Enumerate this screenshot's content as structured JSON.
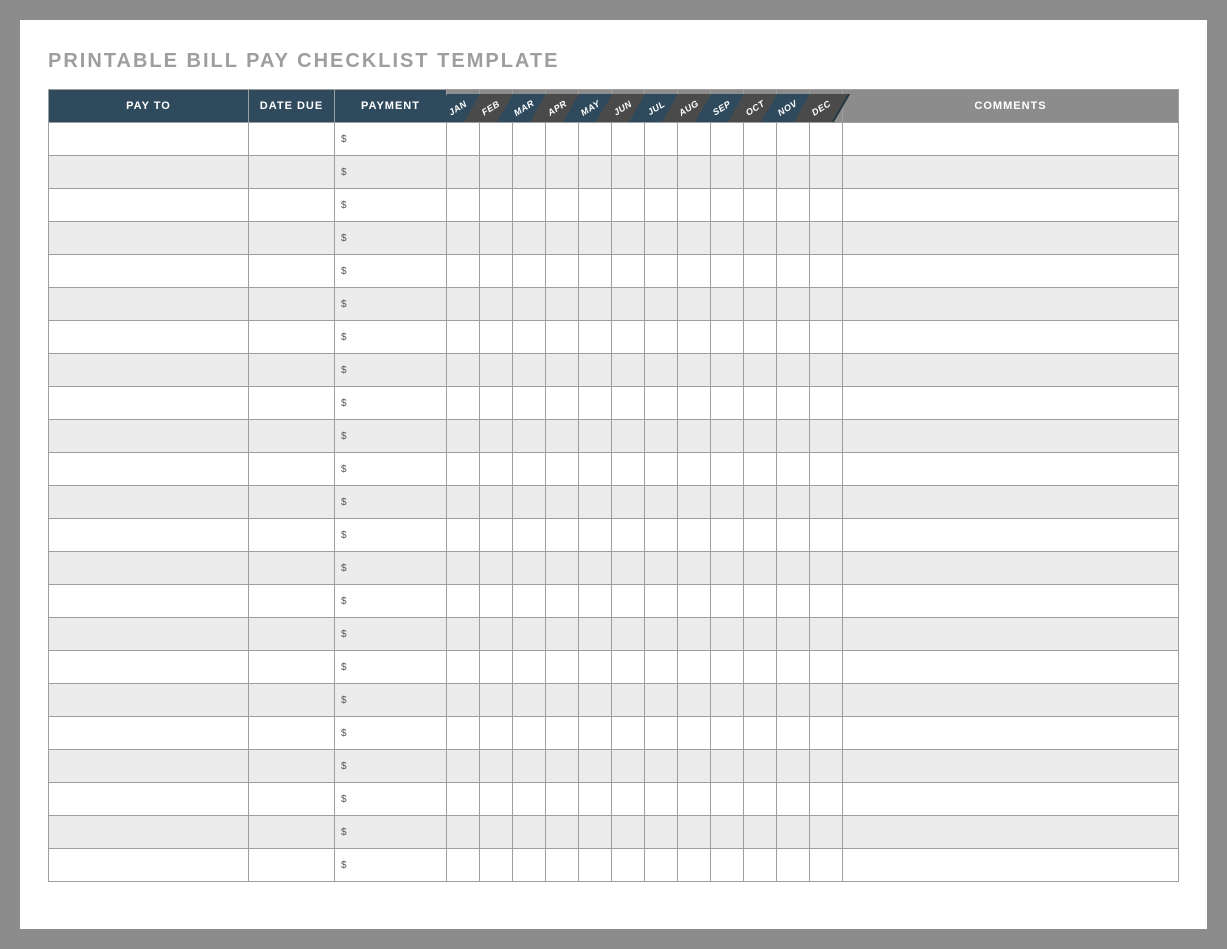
{
  "title": "PRINTABLE BILL PAY CHECKLIST TEMPLATE",
  "headers": {
    "payto": "PAY TO",
    "datedue": "DATE DUE",
    "payment": "PAYMENT",
    "comments": "COMMENTS"
  },
  "months": [
    "JAN",
    "FEB",
    "MAR",
    "APR",
    "MAY",
    "JUN",
    "JUL",
    "AUG",
    "SEP",
    "OCT",
    "NOV",
    "DEC"
  ],
  "currency_symbol": "$",
  "row_count": 23,
  "rows": [
    {
      "payto": "",
      "datedue": "",
      "payment": "",
      "comments": ""
    },
    {
      "payto": "",
      "datedue": "",
      "payment": "",
      "comments": ""
    },
    {
      "payto": "",
      "datedue": "",
      "payment": "",
      "comments": ""
    },
    {
      "payto": "",
      "datedue": "",
      "payment": "",
      "comments": ""
    },
    {
      "payto": "",
      "datedue": "",
      "payment": "",
      "comments": ""
    },
    {
      "payto": "",
      "datedue": "",
      "payment": "",
      "comments": ""
    },
    {
      "payto": "",
      "datedue": "",
      "payment": "",
      "comments": ""
    },
    {
      "payto": "",
      "datedue": "",
      "payment": "",
      "comments": ""
    },
    {
      "payto": "",
      "datedue": "",
      "payment": "",
      "comments": ""
    },
    {
      "payto": "",
      "datedue": "",
      "payment": "",
      "comments": ""
    },
    {
      "payto": "",
      "datedue": "",
      "payment": "",
      "comments": ""
    },
    {
      "payto": "",
      "datedue": "",
      "payment": "",
      "comments": ""
    },
    {
      "payto": "",
      "datedue": "",
      "payment": "",
      "comments": ""
    },
    {
      "payto": "",
      "datedue": "",
      "payment": "",
      "comments": ""
    },
    {
      "payto": "",
      "datedue": "",
      "payment": "",
      "comments": ""
    },
    {
      "payto": "",
      "datedue": "",
      "payment": "",
      "comments": ""
    },
    {
      "payto": "",
      "datedue": "",
      "payment": "",
      "comments": ""
    },
    {
      "payto": "",
      "datedue": "",
      "payment": "",
      "comments": ""
    },
    {
      "payto": "",
      "datedue": "",
      "payment": "",
      "comments": ""
    },
    {
      "payto": "",
      "datedue": "",
      "payment": "",
      "comments": ""
    },
    {
      "payto": "",
      "datedue": "",
      "payment": "",
      "comments": ""
    },
    {
      "payto": "",
      "datedue": "",
      "payment": "",
      "comments": ""
    },
    {
      "payto": "",
      "datedue": "",
      "payment": "",
      "comments": ""
    }
  ],
  "chart_data": {
    "type": "table",
    "title": "Printable Bill Pay Checklist",
    "columns": [
      "PAY TO",
      "DATE DUE",
      "PAYMENT",
      "JAN",
      "FEB",
      "MAR",
      "APR",
      "MAY",
      "JUN",
      "JUL",
      "AUG",
      "SEP",
      "OCT",
      "NOV",
      "DEC",
      "COMMENTS"
    ],
    "rows": []
  }
}
